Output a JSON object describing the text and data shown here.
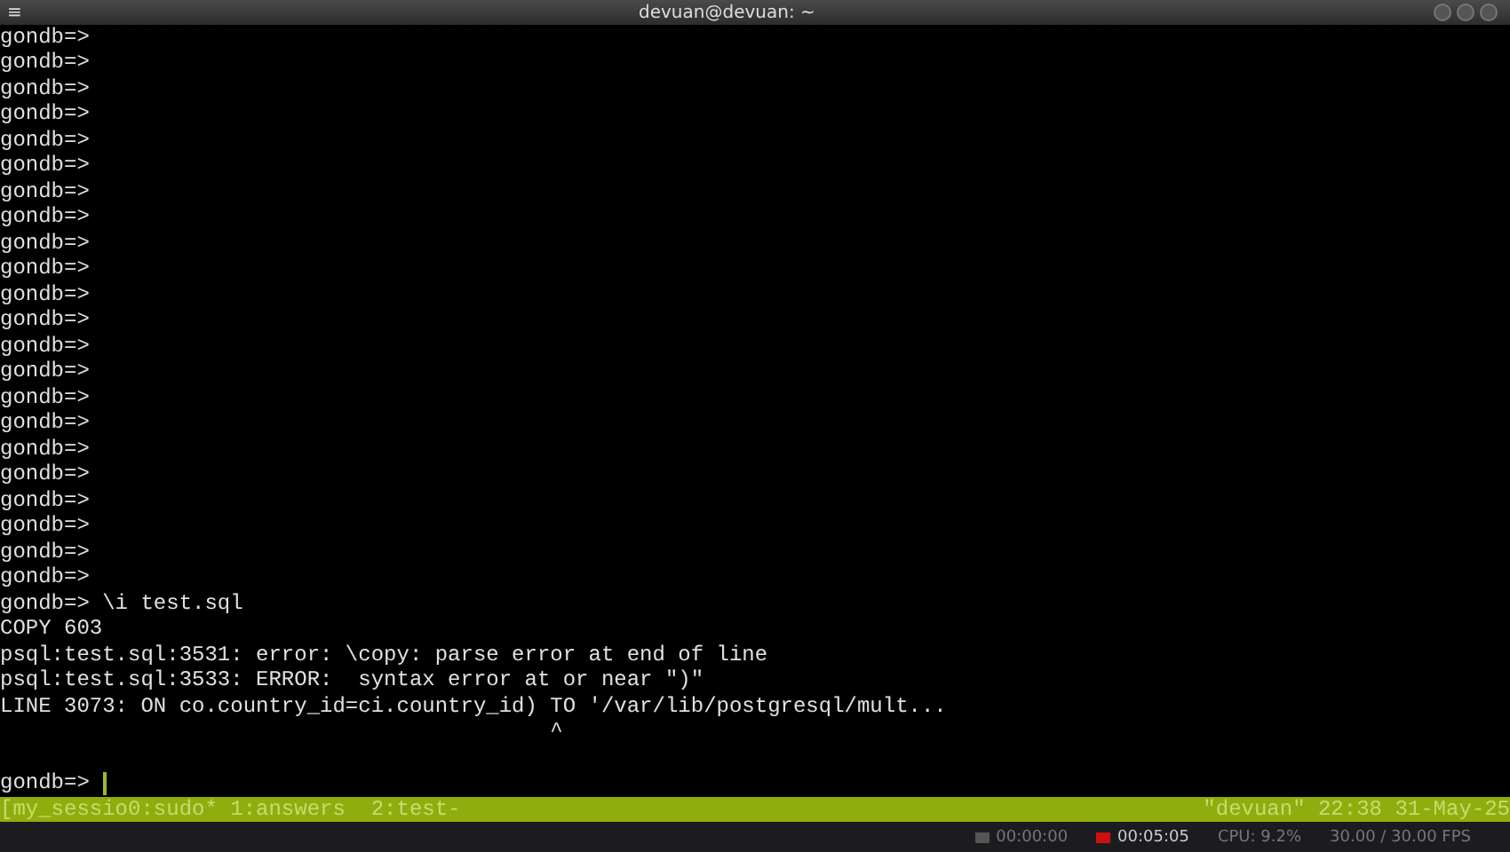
{
  "window": {
    "title": "devuan@devuan: ~",
    "menu_glyph": "≡"
  },
  "terminal": {
    "lines": [
      {
        "kind": "text",
        "text": "gondb=>"
      },
      {
        "kind": "text",
        "text": "gondb=>"
      },
      {
        "kind": "text",
        "text": "gondb=>"
      },
      {
        "kind": "text",
        "text": "gondb=>"
      },
      {
        "kind": "text",
        "text": "gondb=>"
      },
      {
        "kind": "text",
        "text": "gondb=>"
      },
      {
        "kind": "text",
        "text": "gondb=>"
      },
      {
        "kind": "text",
        "text": "gondb=>"
      },
      {
        "kind": "text",
        "text": "gondb=>"
      },
      {
        "kind": "text",
        "text": "gondb=>"
      },
      {
        "kind": "text",
        "text": "gondb=>"
      },
      {
        "kind": "text",
        "text": "gondb=>"
      },
      {
        "kind": "text",
        "text": "gondb=>"
      },
      {
        "kind": "text",
        "text": "gondb=>"
      },
      {
        "kind": "text",
        "text": "gondb=>"
      },
      {
        "kind": "text",
        "text": "gondb=>"
      },
      {
        "kind": "text",
        "text": "gondb=>"
      },
      {
        "kind": "text",
        "text": "gondb=>"
      },
      {
        "kind": "text",
        "text": "gondb=>"
      },
      {
        "kind": "text",
        "text": "gondb=>"
      },
      {
        "kind": "text",
        "text": "gondb=>"
      },
      {
        "kind": "text",
        "text": "gondb=>"
      },
      {
        "kind": "text",
        "text": "gondb=> \\i test.sql"
      },
      {
        "kind": "text",
        "text": "COPY 603"
      },
      {
        "kind": "text",
        "text": "psql:test.sql:3531: error: \\copy: parse error at end of line"
      },
      {
        "kind": "text",
        "text": "psql:test.sql:3533: ERROR:  syntax error at or near \")\""
      },
      {
        "kind": "text",
        "text": "LINE 3073: ON co.country_id=ci.country_id) TO '/var/lib/postgresql/mult..."
      },
      {
        "kind": "text",
        "text": "                                           ^"
      },
      {
        "kind": "blank"
      },
      {
        "kind": "cursor",
        "text": "gondb=> "
      }
    ]
  },
  "tmux": {
    "left": "[my_sessio0:sudo* 1:answers  2:test-",
    "right": "\"devuan\" 22:38 31-May-25"
  },
  "recorder": {
    "items": [
      {
        "text": "00:00:00",
        "recording": false
      },
      {
        "text": "00:05:05",
        "recording": true
      },
      {
        "text": "CPU: 9.2%"
      },
      {
        "text": "30.00 / 30.00 FPS"
      }
    ]
  }
}
